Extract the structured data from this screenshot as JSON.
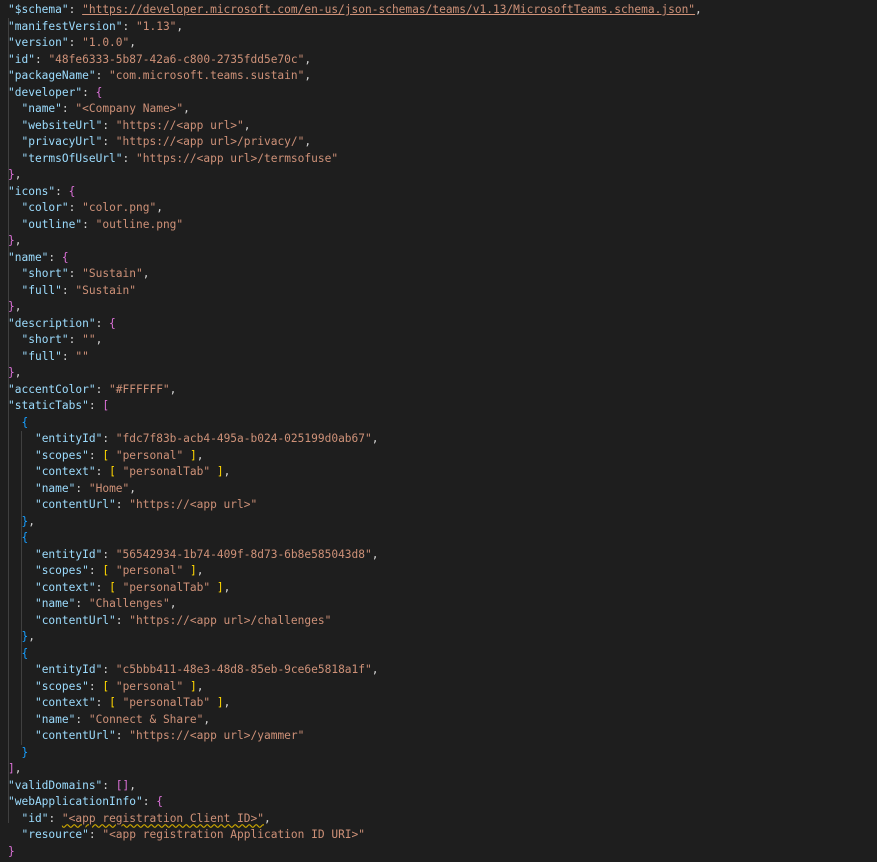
{
  "editor": {
    "lines": [
      [
        {
          "t": "\"$schema\"",
          "c": "k"
        },
        {
          "t": ": ",
          "c": "p"
        },
        {
          "t": "\"https://developer.microsoft.com/en-us/json-schemas/teams/v1.13/MicrosoftTeams.schema.json\"",
          "c": "s u"
        },
        {
          "t": ",",
          "c": "p"
        }
      ],
      [
        {
          "t": "\"manifestVersion\"",
          "c": "k"
        },
        {
          "t": ": ",
          "c": "p"
        },
        {
          "t": "\"1.13\"",
          "c": "s"
        },
        {
          "t": ",",
          "c": "p"
        }
      ],
      [
        {
          "t": "\"version\"",
          "c": "k"
        },
        {
          "t": ": ",
          "c": "p"
        },
        {
          "t": "\"1.0.0\"",
          "c": "s"
        },
        {
          "t": ",",
          "c": "p"
        }
      ],
      [
        {
          "t": "\"id\"",
          "c": "k"
        },
        {
          "t": ": ",
          "c": "p"
        },
        {
          "t": "\"48fe6333-5b87-42a6-c800-2735fdd5e70c\"",
          "c": "s"
        },
        {
          "t": ",",
          "c": "p"
        }
      ],
      [
        {
          "t": "\"packageName\"",
          "c": "k"
        },
        {
          "t": ": ",
          "c": "p"
        },
        {
          "t": "\"com.microsoft.teams.sustain\"",
          "c": "s"
        },
        {
          "t": ",",
          "c": "p"
        }
      ],
      [
        {
          "t": "\"developer\"",
          "c": "k"
        },
        {
          "t": ": ",
          "c": "p"
        },
        {
          "t": "{",
          "c": "b2"
        }
      ],
      [
        {
          "t": "  ",
          "c": "p"
        },
        {
          "t": "\"name\"",
          "c": "k"
        },
        {
          "t": ": ",
          "c": "p"
        },
        {
          "t": "\"<Company Name>\"",
          "c": "s"
        },
        {
          "t": ",",
          "c": "p"
        }
      ],
      [
        {
          "t": "  ",
          "c": "p"
        },
        {
          "t": "\"websiteUrl\"",
          "c": "k"
        },
        {
          "t": ": ",
          "c": "p"
        },
        {
          "t": "\"https://<app url>\"",
          "c": "s"
        },
        {
          "t": ",",
          "c": "p"
        }
      ],
      [
        {
          "t": "  ",
          "c": "p"
        },
        {
          "t": "\"privacyUrl\"",
          "c": "k"
        },
        {
          "t": ": ",
          "c": "p"
        },
        {
          "t": "\"https://<app url>/privacy/\"",
          "c": "s"
        },
        {
          "t": ",",
          "c": "p"
        }
      ],
      [
        {
          "t": "  ",
          "c": "p"
        },
        {
          "t": "\"termsOfUseUrl\"",
          "c": "k"
        },
        {
          "t": ": ",
          "c": "p"
        },
        {
          "t": "\"https://<app url>/termsofuse\"",
          "c": "s"
        }
      ],
      [
        {
          "t": "}",
          "c": "b2"
        },
        {
          "t": ",",
          "c": "p"
        }
      ],
      [
        {
          "t": "\"icons\"",
          "c": "k"
        },
        {
          "t": ": ",
          "c": "p"
        },
        {
          "t": "{",
          "c": "b2"
        }
      ],
      [
        {
          "t": "  ",
          "c": "p"
        },
        {
          "t": "\"color\"",
          "c": "k"
        },
        {
          "t": ": ",
          "c": "p"
        },
        {
          "t": "\"color.png\"",
          "c": "s"
        },
        {
          "t": ",",
          "c": "p"
        }
      ],
      [
        {
          "t": "  ",
          "c": "p"
        },
        {
          "t": "\"outline\"",
          "c": "k"
        },
        {
          "t": ": ",
          "c": "p"
        },
        {
          "t": "\"outline.png\"",
          "c": "s"
        }
      ],
      [
        {
          "t": "}",
          "c": "b2"
        },
        {
          "t": ",",
          "c": "p"
        }
      ],
      [
        {
          "t": "\"name\"",
          "c": "k"
        },
        {
          "t": ": ",
          "c": "p"
        },
        {
          "t": "{",
          "c": "b2"
        }
      ],
      [
        {
          "t": "  ",
          "c": "p"
        },
        {
          "t": "\"short\"",
          "c": "k"
        },
        {
          "t": ": ",
          "c": "p"
        },
        {
          "t": "\"Sustain\"",
          "c": "s"
        },
        {
          "t": ",",
          "c": "p"
        }
      ],
      [
        {
          "t": "  ",
          "c": "p"
        },
        {
          "t": "\"full\"",
          "c": "k"
        },
        {
          "t": ": ",
          "c": "p"
        },
        {
          "t": "\"Sustain\"",
          "c": "s"
        }
      ],
      [
        {
          "t": "}",
          "c": "b2"
        },
        {
          "t": ",",
          "c": "p"
        }
      ],
      [
        {
          "t": "\"description\"",
          "c": "k"
        },
        {
          "t": ": ",
          "c": "p"
        },
        {
          "t": "{",
          "c": "b2"
        }
      ],
      [
        {
          "t": "  ",
          "c": "p"
        },
        {
          "t": "\"short\"",
          "c": "k"
        },
        {
          "t": ": ",
          "c": "p"
        },
        {
          "t": "\"\"",
          "c": "s"
        },
        {
          "t": ",",
          "c": "p"
        }
      ],
      [
        {
          "t": "  ",
          "c": "p"
        },
        {
          "t": "\"full\"",
          "c": "k"
        },
        {
          "t": ": ",
          "c": "p"
        },
        {
          "t": "\"\"",
          "c": "s"
        }
      ],
      [
        {
          "t": "}",
          "c": "b2"
        },
        {
          "t": ",",
          "c": "p"
        }
      ],
      [
        {
          "t": "\"accentColor\"",
          "c": "k"
        },
        {
          "t": ": ",
          "c": "p"
        },
        {
          "t": "\"#FFFFFF\"",
          "c": "s"
        },
        {
          "t": ",",
          "c": "p"
        }
      ],
      [
        {
          "t": "\"staticTabs\"",
          "c": "k"
        },
        {
          "t": ": ",
          "c": "p"
        },
        {
          "t": "[",
          "c": "b2"
        }
      ],
      [
        {
          "t": "  ",
          "c": "p"
        },
        {
          "t": "{",
          "c": "b3"
        }
      ],
      [
        {
          "t": "    ",
          "c": "p"
        },
        {
          "t": "\"entityId\"",
          "c": "k"
        },
        {
          "t": ": ",
          "c": "p"
        },
        {
          "t": "\"fdc7f83b-acb4-495a-b024-025199d0ab67\"",
          "c": "s"
        },
        {
          "t": ",",
          "c": "p"
        }
      ],
      [
        {
          "t": "    ",
          "c": "p"
        },
        {
          "t": "\"scopes\"",
          "c": "k"
        },
        {
          "t": ": ",
          "c": "p"
        },
        {
          "t": "[",
          "c": "b1"
        },
        {
          "t": " ",
          "c": "p"
        },
        {
          "t": "\"personal\"",
          "c": "s"
        },
        {
          "t": " ",
          "c": "p"
        },
        {
          "t": "]",
          "c": "b1"
        },
        {
          "t": ",",
          "c": "p"
        }
      ],
      [
        {
          "t": "    ",
          "c": "p"
        },
        {
          "t": "\"context\"",
          "c": "k"
        },
        {
          "t": ": ",
          "c": "p"
        },
        {
          "t": "[",
          "c": "b1"
        },
        {
          "t": " ",
          "c": "p"
        },
        {
          "t": "\"personalTab\"",
          "c": "s"
        },
        {
          "t": " ",
          "c": "p"
        },
        {
          "t": "]",
          "c": "b1"
        },
        {
          "t": ",",
          "c": "p"
        }
      ],
      [
        {
          "t": "    ",
          "c": "p"
        },
        {
          "t": "\"name\"",
          "c": "k"
        },
        {
          "t": ": ",
          "c": "p"
        },
        {
          "t": "\"Home\"",
          "c": "s"
        },
        {
          "t": ",",
          "c": "p"
        }
      ],
      [
        {
          "t": "    ",
          "c": "p"
        },
        {
          "t": "\"contentUrl\"",
          "c": "k"
        },
        {
          "t": ": ",
          "c": "p"
        },
        {
          "t": "\"https://<app url>\"",
          "c": "s"
        }
      ],
      [
        {
          "t": "  ",
          "c": "p"
        },
        {
          "t": "}",
          "c": "b3"
        },
        {
          "t": ",",
          "c": "p"
        }
      ],
      [
        {
          "t": "  ",
          "c": "p"
        },
        {
          "t": "{",
          "c": "b3"
        }
      ],
      [
        {
          "t": "    ",
          "c": "p"
        },
        {
          "t": "\"entityId\"",
          "c": "k"
        },
        {
          "t": ": ",
          "c": "p"
        },
        {
          "t": "\"56542934-1b74-409f-8d73-6b8e585043d8\"",
          "c": "s"
        },
        {
          "t": ",",
          "c": "p"
        }
      ],
      [
        {
          "t": "    ",
          "c": "p"
        },
        {
          "t": "\"scopes\"",
          "c": "k"
        },
        {
          "t": ": ",
          "c": "p"
        },
        {
          "t": "[",
          "c": "b1"
        },
        {
          "t": " ",
          "c": "p"
        },
        {
          "t": "\"personal\"",
          "c": "s"
        },
        {
          "t": " ",
          "c": "p"
        },
        {
          "t": "]",
          "c": "b1"
        },
        {
          "t": ",",
          "c": "p"
        }
      ],
      [
        {
          "t": "    ",
          "c": "p"
        },
        {
          "t": "\"context\"",
          "c": "k"
        },
        {
          "t": ": ",
          "c": "p"
        },
        {
          "t": "[",
          "c": "b1"
        },
        {
          "t": " ",
          "c": "p"
        },
        {
          "t": "\"personalTab\"",
          "c": "s"
        },
        {
          "t": " ",
          "c": "p"
        },
        {
          "t": "]",
          "c": "b1"
        },
        {
          "t": ",",
          "c": "p"
        }
      ],
      [
        {
          "t": "    ",
          "c": "p"
        },
        {
          "t": "\"name\"",
          "c": "k"
        },
        {
          "t": ": ",
          "c": "p"
        },
        {
          "t": "\"Challenges\"",
          "c": "s"
        },
        {
          "t": ",",
          "c": "p"
        }
      ],
      [
        {
          "t": "    ",
          "c": "p"
        },
        {
          "t": "\"contentUrl\"",
          "c": "k"
        },
        {
          "t": ": ",
          "c": "p"
        },
        {
          "t": "\"https://<app url>/challenges\"",
          "c": "s"
        }
      ],
      [
        {
          "t": "  ",
          "c": "p"
        },
        {
          "t": "}",
          "c": "b3"
        },
        {
          "t": ",",
          "c": "p"
        }
      ],
      [
        {
          "t": "  ",
          "c": "p"
        },
        {
          "t": "{",
          "c": "b3"
        }
      ],
      [
        {
          "t": "    ",
          "c": "p"
        },
        {
          "t": "\"entityId\"",
          "c": "k"
        },
        {
          "t": ": ",
          "c": "p"
        },
        {
          "t": "\"c5bbb411-48e3-48d8-85eb-9ce6e5818a1f\"",
          "c": "s"
        },
        {
          "t": ",",
          "c": "p"
        }
      ],
      [
        {
          "t": "    ",
          "c": "p"
        },
        {
          "t": "\"scopes\"",
          "c": "k"
        },
        {
          "t": ": ",
          "c": "p"
        },
        {
          "t": "[",
          "c": "b1"
        },
        {
          "t": " ",
          "c": "p"
        },
        {
          "t": "\"personal\"",
          "c": "s"
        },
        {
          "t": " ",
          "c": "p"
        },
        {
          "t": "]",
          "c": "b1"
        },
        {
          "t": ",",
          "c": "p"
        }
      ],
      [
        {
          "t": "    ",
          "c": "p"
        },
        {
          "t": "\"context\"",
          "c": "k"
        },
        {
          "t": ": ",
          "c": "p"
        },
        {
          "t": "[",
          "c": "b1"
        },
        {
          "t": " ",
          "c": "p"
        },
        {
          "t": "\"personalTab\"",
          "c": "s"
        },
        {
          "t": " ",
          "c": "p"
        },
        {
          "t": "]",
          "c": "b1"
        },
        {
          "t": ",",
          "c": "p"
        }
      ],
      [
        {
          "t": "    ",
          "c": "p"
        },
        {
          "t": "\"name\"",
          "c": "k"
        },
        {
          "t": ": ",
          "c": "p"
        },
        {
          "t": "\"Connect & Share\"",
          "c": "s"
        },
        {
          "t": ",",
          "c": "p"
        }
      ],
      [
        {
          "t": "    ",
          "c": "p"
        },
        {
          "t": "\"contentUrl\"",
          "c": "k"
        },
        {
          "t": ": ",
          "c": "p"
        },
        {
          "t": "\"https://<app url>/yammer\"",
          "c": "s"
        }
      ],
      [
        {
          "t": "  ",
          "c": "p"
        },
        {
          "t": "}",
          "c": "b3"
        }
      ],
      [
        {
          "t": "]",
          "c": "b2"
        },
        {
          "t": ",",
          "c": "p"
        }
      ],
      [
        {
          "t": "\"validDomains\"",
          "c": "k"
        },
        {
          "t": ": ",
          "c": "p"
        },
        {
          "t": "[]",
          "c": "b2"
        },
        {
          "t": ",",
          "c": "p"
        }
      ],
      [
        {
          "t": "\"webApplicationInfo\"",
          "c": "k"
        },
        {
          "t": ": ",
          "c": "p"
        },
        {
          "t": "{",
          "c": "b2"
        }
      ],
      [
        {
          "t": "  ",
          "c": "p"
        },
        {
          "t": "\"id\"",
          "c": "k"
        },
        {
          "t": ": ",
          "c": "p"
        },
        {
          "t": "\"<app registration Client ID>\"",
          "c": "s sq"
        },
        {
          "t": ",",
          "c": "p"
        }
      ],
      [
        {
          "t": "  ",
          "c": "p"
        },
        {
          "t": "\"resource\"",
          "c": "k"
        },
        {
          "t": ": ",
          "c": "p"
        },
        {
          "t": "\"<app registration Application ID URI>\"",
          "c": "s"
        }
      ],
      [
        {
          "t": "}",
          "c": "b2"
        }
      ]
    ],
    "colors": {
      "background": "#1e1e1e",
      "property_key": "#9cdcfe",
      "string_value": "#ce9178",
      "punctuation": "#d4d4d4",
      "bracket_gold": "#ffd700",
      "bracket_orchid": "#da70d6",
      "bracket_blue": "#179fff",
      "warning_squiggle": "#cca700"
    }
  }
}
